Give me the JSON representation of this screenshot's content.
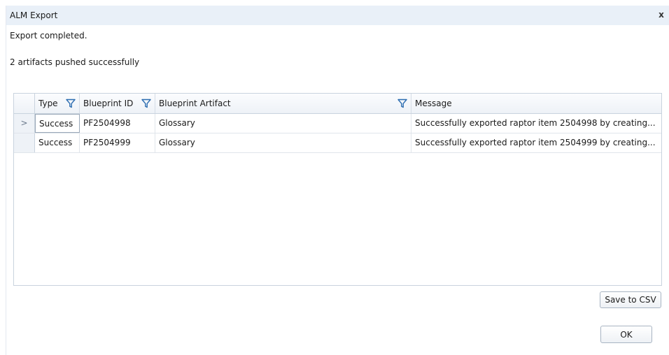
{
  "dialog": {
    "title": "ALM Export",
    "close_label": "x"
  },
  "messages": {
    "status": "Export completed.",
    "summary": "2 artifacts pushed successfully"
  },
  "grid": {
    "columns": [
      {
        "label": "Type",
        "filter_icon": "funnel-icon"
      },
      {
        "label": "Blueprint ID",
        "filter_icon": "funnel-icon"
      },
      {
        "label": "Blueprint Artifact",
        "filter_icon": "funnel-icon"
      },
      {
        "label": "Message"
      }
    ],
    "current_row_indicator": ">",
    "rows": [
      {
        "type": "Success",
        "blueprint_id": "PF2504998",
        "artifact": "Glossary",
        "message": "Successfully exported raptor item 2504998 by creating..."
      },
      {
        "type": "Success",
        "blueprint_id": "PF2504999",
        "artifact": "Glossary",
        "message": "Successfully exported raptor item 2504999 by creating..."
      }
    ]
  },
  "buttons": {
    "save_csv": "Save to CSV",
    "ok": "OK"
  },
  "colors": {
    "titlebar": "#e9f0f8",
    "accent_filter": "#2b6cb0",
    "border": "#c9d3de"
  }
}
